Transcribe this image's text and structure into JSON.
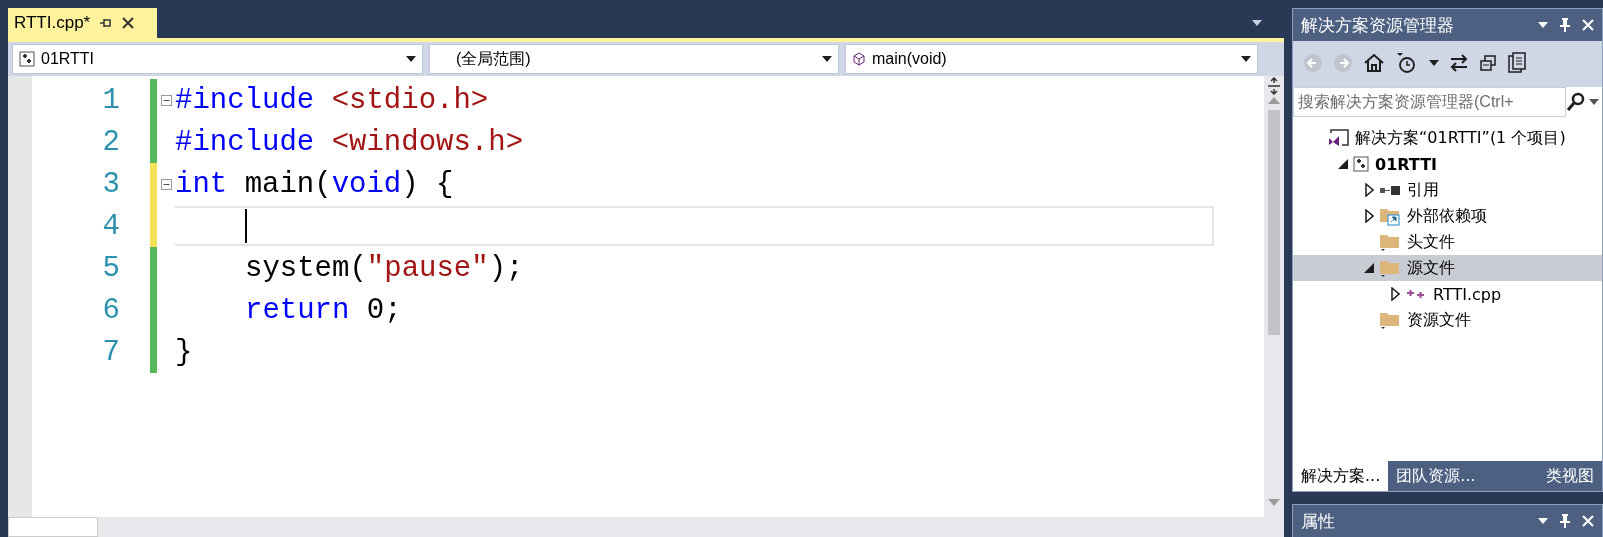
{
  "document_tab": {
    "label": "RTTI.cpp*",
    "selected": true
  },
  "navigation_bar": {
    "project": "01RTTI",
    "scope": "(全局范围)",
    "member": "main(void)"
  },
  "code_lines": [
    {
      "number": "1",
      "saved": true,
      "fold": true,
      "current": false,
      "indented": false,
      "tokens": [
        {
          "kind": "preprocessor",
          "text": "#include "
        },
        {
          "kind": "string",
          "text": "<stdio.h>"
        }
      ]
    },
    {
      "number": "2",
      "saved": true,
      "fold": false,
      "current": false,
      "indented": false,
      "tokens": [
        {
          "kind": "preprocessor",
          "text": "#include "
        },
        {
          "kind": "string",
          "text": "<windows.h>"
        }
      ]
    },
    {
      "number": "3",
      "saved": false,
      "fold": true,
      "current": false,
      "indented": false,
      "tokens": [
        {
          "kind": "keyword",
          "text": "int "
        },
        {
          "kind": "plain",
          "text": "main("
        },
        {
          "kind": "keyword",
          "text": "void"
        },
        {
          "kind": "plain",
          "text": ") {"
        }
      ]
    },
    {
      "number": "4",
      "saved": false,
      "fold": false,
      "current": true,
      "indented": true
    },
    {
      "number": "5",
      "saved": true,
      "fold": false,
      "current": false,
      "indented": true,
      "tokens": [
        {
          "kind": "plain",
          "text": "system("
        },
        {
          "kind": "string",
          "text": "\"pause\""
        },
        {
          "kind": "plain",
          "text": ");"
        }
      ]
    },
    {
      "number": "6",
      "saved": true,
      "fold": false,
      "current": false,
      "indented": true,
      "tokens": [
        {
          "kind": "keyword",
          "text": "return "
        },
        {
          "kind": "plain",
          "text": "0;"
        }
      ]
    },
    {
      "number": "7",
      "saved": true,
      "fold": false,
      "current": false,
      "indented": false,
      "tokens": [
        {
          "kind": "plain",
          "text": "}"
        }
      ]
    }
  ],
  "solution_explorer": {
    "title": "解决方案资源管理器",
    "search": {
      "placeholder": "搜索解决方案资源管理器(Ctrl+"
    },
    "tree": [
      {
        "label": "解决方案“01RTTI”(1 个项目)",
        "kind": "solution",
        "expandable": false,
        "bold": false,
        "selected": false,
        "children": [
          {
            "label": "01RTTI",
            "kind": "project",
            "expandable": true,
            "expanded": true,
            "bold": true,
            "selected": false,
            "children": [
              {
                "label": "引用",
                "kind": "references",
                "expandable": true,
                "expanded": false,
                "bold": false,
                "selected": false
              },
              {
                "label": "外部依赖项",
                "kind": "external",
                "expandable": true,
                "expanded": false,
                "bold": false,
                "selected": false
              },
              {
                "label": "头文件",
                "kind": "folder",
                "expandable": false,
                "expanded": false,
                "bold": false,
                "selected": false
              },
              {
                "label": "源文件",
                "kind": "folder",
                "expandable": true,
                "expanded": true,
                "bold": false,
                "selected": true,
                "children": [
                  {
                    "label": "RTTI.cpp",
                    "kind": "cpp",
                    "expandable": true,
                    "expanded": false,
                    "bold": false,
                    "selected": false
                  }
                ]
              },
              {
                "label": "资源文件",
                "kind": "folder",
                "expandable": false,
                "expanded": false,
                "bold": false,
                "selected": false
              }
            ]
          }
        ]
      }
    ],
    "tabs": [
      {
        "label": "解决方案...",
        "selected": true
      },
      {
        "label": "团队资源...",
        "selected": false
      },
      {
        "label": "类视图",
        "selected": false
      }
    ]
  },
  "properties_panel": {
    "title": "属性"
  }
}
